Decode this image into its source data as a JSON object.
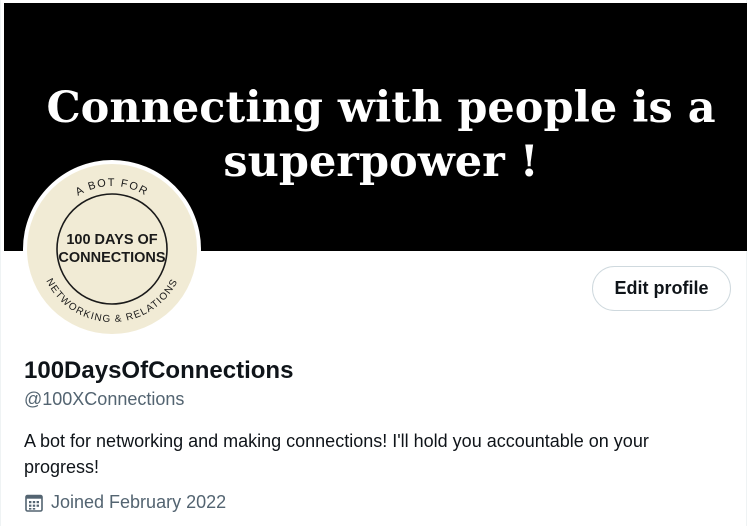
{
  "banner": {
    "line1": "Connecting with people is a",
    "line2": "superpower !"
  },
  "avatar": {
    "arc_top": "A BOT FOR",
    "center_line1": "100 DAYS OF",
    "center_line2": "CONNECTIONS",
    "arc_bottom": "NETWORKING & RELATIONS"
  },
  "profile": {
    "edit_label": "Edit profile",
    "display_name": "100DaysOfConnections",
    "handle": "@100XConnections",
    "bio": "A bot for networking and making connections! I'll hold you accountable on your progress!",
    "joined": "Joined February 2022",
    "joined_icon": "calendar-icon"
  },
  "colors": {
    "banner_bg": "#000000",
    "avatar_bg": "#f1ebd5",
    "text_primary": "#0f1419",
    "text_secondary": "#536471",
    "border": "#cfd9de"
  }
}
